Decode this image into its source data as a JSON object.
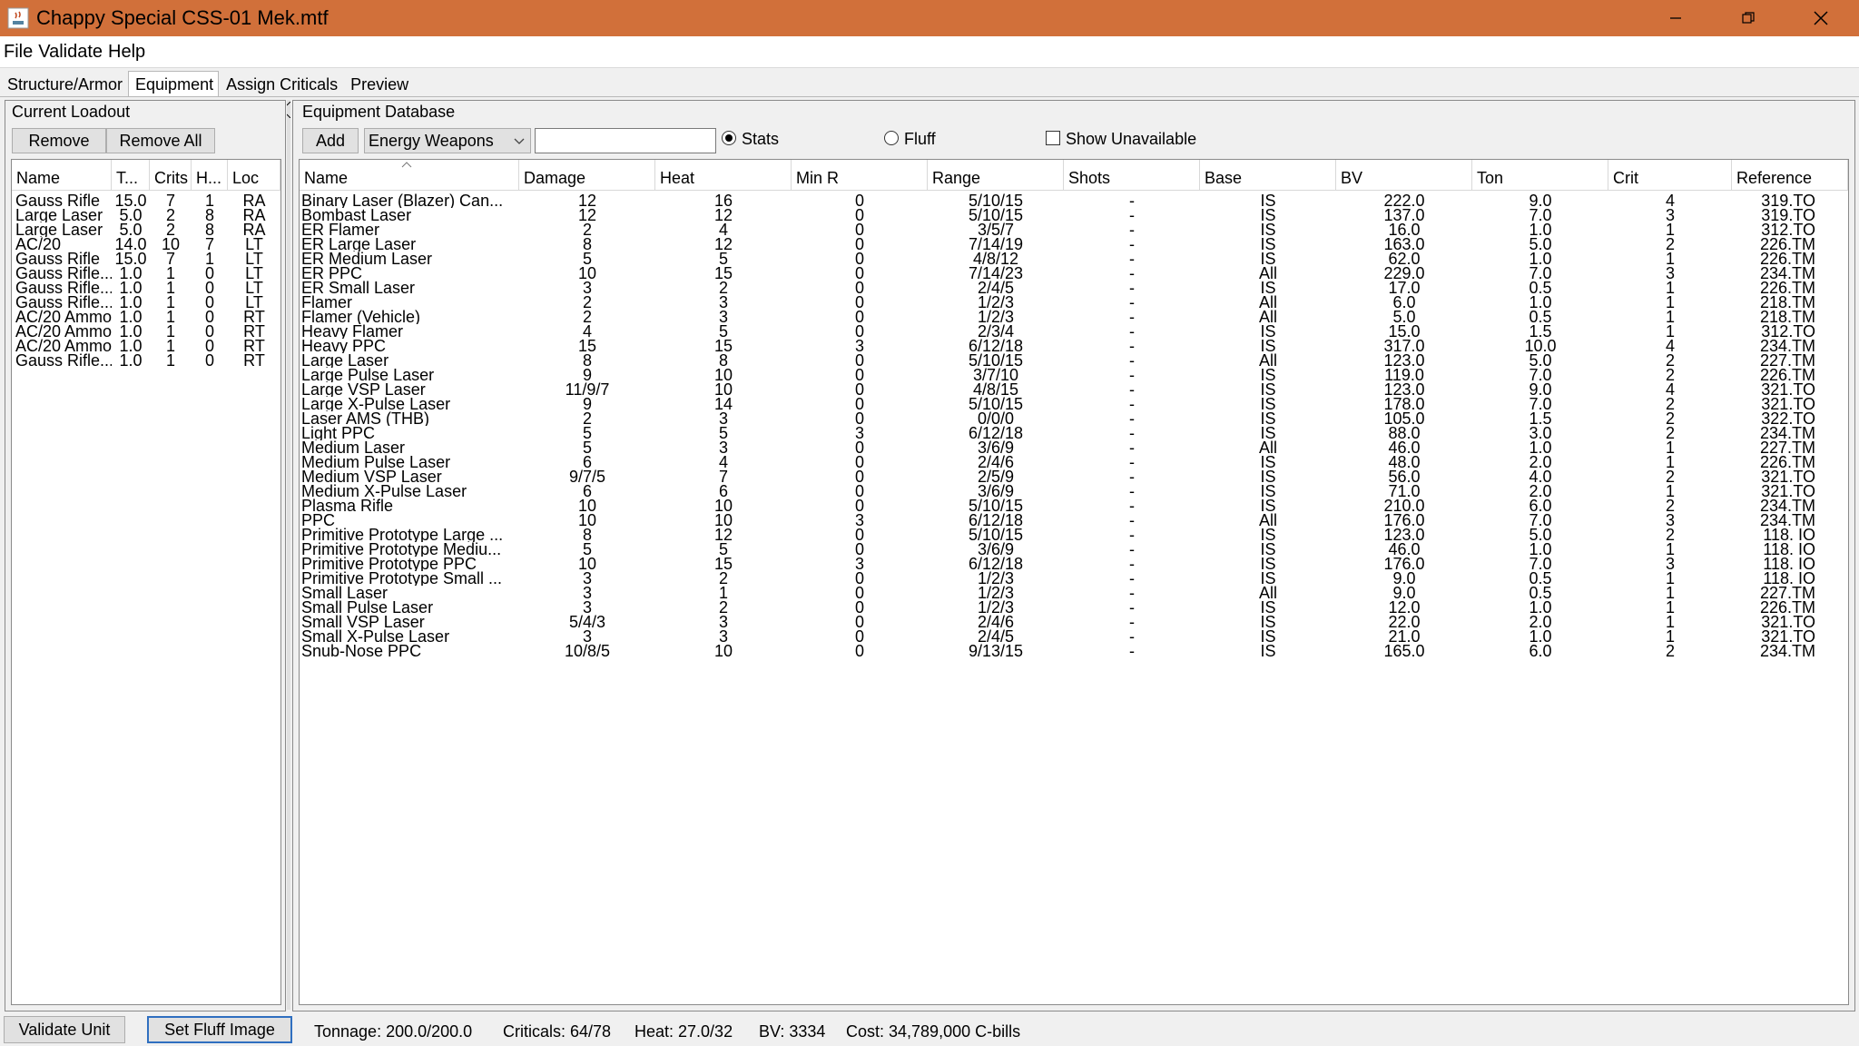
{
  "window": {
    "title": "Chappy Special  CSS-01 Mek.mtf"
  },
  "menu": [
    "File",
    "Validate",
    "Help"
  ],
  "tabs": [
    "Structure/Armor",
    "Equipment",
    "Assign Criticals",
    "Preview"
  ],
  "loadout": {
    "title": "Current Loadout",
    "remove_label": "Remove",
    "remove_all_label": "Remove All",
    "columns": [
      "Name",
      "T...",
      "Crits",
      "H...",
      "Loc"
    ],
    "rows": [
      [
        "Gauss Rifle",
        "15.0",
        "7",
        "1",
        "RA"
      ],
      [
        "Large Laser",
        "5.0",
        "2",
        "8",
        "RA"
      ],
      [
        "Large Laser",
        "5.0",
        "2",
        "8",
        "RA"
      ],
      [
        "AC/20",
        "14.0",
        "10",
        "7",
        "LT"
      ],
      [
        "Gauss Rifle",
        "15.0",
        "7",
        "1",
        "LT"
      ],
      [
        "Gauss Rifle...",
        "1.0",
        "1",
        "0",
        "LT"
      ],
      [
        "Gauss Rifle...",
        "1.0",
        "1",
        "0",
        "LT"
      ],
      [
        "Gauss Rifle...",
        "1.0",
        "1",
        "0",
        "LT"
      ],
      [
        "AC/20 Ammo",
        "1.0",
        "1",
        "0",
        "RT"
      ],
      [
        "AC/20 Ammo",
        "1.0",
        "1",
        "0",
        "RT"
      ],
      [
        "AC/20 Ammo",
        "1.0",
        "1",
        "0",
        "RT"
      ],
      [
        "Gauss Rifle...",
        "1.0",
        "1",
        "0",
        "RT"
      ]
    ]
  },
  "database": {
    "title": "Equipment Database",
    "add_label": "Add",
    "category": "Energy Weapons",
    "search_value": "",
    "stats_label": "Stats",
    "fluff_label": "Fluff",
    "show_unavailable_label": "Show Unavailable",
    "stats_selected": true,
    "columns": [
      "Name",
      "Damage",
      "Heat",
      "Min R",
      "Range",
      "Shots",
      "Base",
      "BV",
      "Ton",
      "Crit",
      "Reference"
    ],
    "rows": [
      [
        "Binary Laser (Blazer) Can...",
        "12",
        "16",
        "0",
        "5/10/15",
        "-",
        "IS",
        "222.0",
        "9.0",
        "4",
        "319.TO"
      ],
      [
        "Bombast Laser",
        "12",
        "12",
        "0",
        "5/10/15",
        "-",
        "IS",
        "137.0",
        "7.0",
        "3",
        "319.TO"
      ],
      [
        "ER Flamer",
        "2",
        "4",
        "0",
        "3/5/7",
        "-",
        "IS",
        "16.0",
        "1.0",
        "1",
        "312.TO"
      ],
      [
        "ER Large Laser",
        "8",
        "12",
        "0",
        "7/14/19",
        "-",
        "IS",
        "163.0",
        "5.0",
        "2",
        "226.TM"
      ],
      [
        "ER Medium Laser",
        "5",
        "5",
        "0",
        "4/8/12",
        "-",
        "IS",
        "62.0",
        "1.0",
        "1",
        "226.TM"
      ],
      [
        "ER PPC",
        "10",
        "15",
        "0",
        "7/14/23",
        "-",
        "All",
        "229.0",
        "7.0",
        "3",
        "234.TM"
      ],
      [
        "ER Small Laser",
        "3",
        "2",
        "0",
        "2/4/5",
        "-",
        "IS",
        "17.0",
        "0.5",
        "1",
        "226.TM"
      ],
      [
        "Flamer",
        "2",
        "3",
        "0",
        "1/2/3",
        "-",
        "All",
        "6.0",
        "1.0",
        "1",
        "218.TM"
      ],
      [
        "Flamer (Vehicle)",
        "2",
        "3",
        "0",
        "1/2/3",
        "-",
        "All",
        "5.0",
        "0.5",
        "1",
        "218.TM"
      ],
      [
        "Heavy Flamer",
        "4",
        "5",
        "0",
        "2/3/4",
        "-",
        "IS",
        "15.0",
        "1.5",
        "1",
        "312.TO"
      ],
      [
        "Heavy PPC",
        "15",
        "15",
        "3",
        "6/12/18",
        "-",
        "IS",
        "317.0",
        "10.0",
        "4",
        "234.TM"
      ],
      [
        "Large Laser",
        "8",
        "8",
        "0",
        "5/10/15",
        "-",
        "All",
        "123.0",
        "5.0",
        "2",
        "227.TM"
      ],
      [
        "Large Pulse Laser",
        "9",
        "10",
        "0",
        "3/7/10",
        "-",
        "IS",
        "119.0",
        "7.0",
        "2",
        "226.TM"
      ],
      [
        "Large VSP Laser",
        "11/9/7",
        "10",
        "0",
        "4/8/15",
        "-",
        "IS",
        "123.0",
        "9.0",
        "4",
        "321.TO"
      ],
      [
        "Large X-Pulse Laser",
        "9",
        "14",
        "0",
        "5/10/15",
        "-",
        "IS",
        "178.0",
        "7.0",
        "2",
        "321.TO"
      ],
      [
        "Laser AMS (THB)",
        "2",
        "3",
        "0",
        "0/0/0",
        "-",
        "IS",
        "105.0",
        "1.5",
        "2",
        "322.TO"
      ],
      [
        "Light PPC",
        "5",
        "5",
        "3",
        "6/12/18",
        "-",
        "IS",
        "88.0",
        "3.0",
        "2",
        "234.TM"
      ],
      [
        "Medium Laser",
        "5",
        "3",
        "0",
        "3/6/9",
        "-",
        "All",
        "46.0",
        "1.0",
        "1",
        "227.TM"
      ],
      [
        "Medium Pulse Laser",
        "6",
        "4",
        "0",
        "2/4/6",
        "-",
        "IS",
        "48.0",
        "2.0",
        "1",
        "226.TM"
      ],
      [
        "Medium VSP Laser",
        "9/7/5",
        "7",
        "0",
        "2/5/9",
        "-",
        "IS",
        "56.0",
        "4.0",
        "2",
        "321.TO"
      ],
      [
        "Medium X-Pulse Laser",
        "6",
        "6",
        "0",
        "3/6/9",
        "-",
        "IS",
        "71.0",
        "2.0",
        "1",
        "321.TO"
      ],
      [
        "Plasma Rifle",
        "10",
        "10",
        "0",
        "5/10/15",
        "-",
        "IS",
        "210.0",
        "6.0",
        "2",
        "234.TM"
      ],
      [
        "PPC",
        "10",
        "10",
        "3",
        "6/12/18",
        "-",
        "All",
        "176.0",
        "7.0",
        "3",
        "234.TM"
      ],
      [
        "Primitive Prototype Large ...",
        "8",
        "12",
        "0",
        "5/10/15",
        "-",
        "IS",
        "123.0",
        "5.0",
        "2",
        "118. IO"
      ],
      [
        "Primitive Prototype Mediu...",
        "5",
        "5",
        "0",
        "3/6/9",
        "-",
        "IS",
        "46.0",
        "1.0",
        "1",
        "118. IO"
      ],
      [
        "Primitive Prototype PPC",
        "10",
        "15",
        "3",
        "6/12/18",
        "-",
        "IS",
        "176.0",
        "7.0",
        "3",
        "118. IO"
      ],
      [
        "Primitive Prototype Small ...",
        "3",
        "2",
        "0",
        "1/2/3",
        "-",
        "IS",
        "9.0",
        "0.5",
        "1",
        "118. IO"
      ],
      [
        "Small Laser",
        "3",
        "1",
        "0",
        "1/2/3",
        "-",
        "All",
        "9.0",
        "0.5",
        "1",
        "227.TM"
      ],
      [
        "Small Pulse Laser",
        "3",
        "2",
        "0",
        "1/2/3",
        "-",
        "IS",
        "12.0",
        "1.0",
        "1",
        "226.TM"
      ],
      [
        "Small VSP Laser",
        "5/4/3",
        "3",
        "0",
        "2/4/6",
        "-",
        "IS",
        "22.0",
        "2.0",
        "1",
        "321.TO"
      ],
      [
        "Small X-Pulse Laser",
        "3",
        "3",
        "0",
        "2/4/5",
        "-",
        "IS",
        "21.0",
        "1.0",
        "1",
        "321.TO"
      ],
      [
        "Snub-Nose PPC",
        "10/8/5",
        "10",
        "0",
        "9/13/15",
        "-",
        "IS",
        "165.0",
        "6.0",
        "2",
        "234.TM"
      ]
    ]
  },
  "status": {
    "validate_label": "Validate Unit",
    "fluff_image_label": "Set Fluff Image",
    "tonnage": "Tonnage: 200.0/200.0",
    "criticals": "Criticals: 64/78",
    "heat": "Heat: 27.0/32",
    "bv": "BV: 3334",
    "cost": "Cost: 34,789,000 C-bills"
  },
  "colors": {
    "titlebar": "#d1703a",
    "focus": "#2f6fc0"
  }
}
